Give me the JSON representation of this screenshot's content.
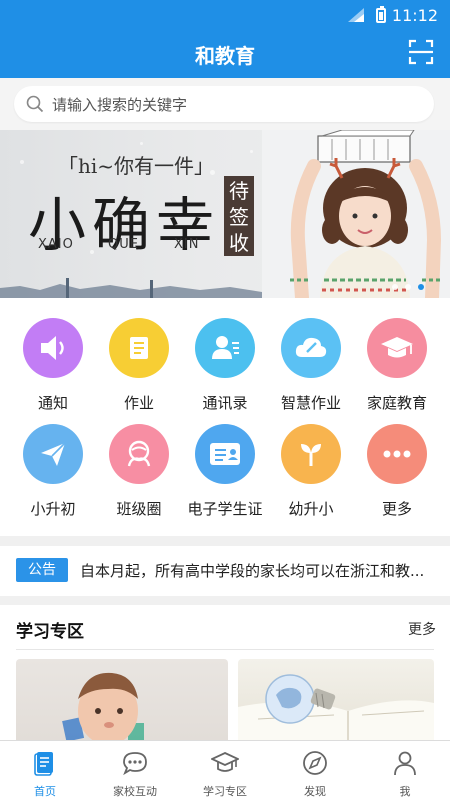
{
  "status_bar": {
    "time": "11:12"
  },
  "header": {
    "title": "和教育"
  },
  "search": {
    "placeholder": "请输入搜索的关键字"
  },
  "banner": {
    "quote": "「hi~你有一件」",
    "headline": "小确幸",
    "pinyin": [
      "XAIO",
      "QUE",
      "XIN"
    ],
    "seal": [
      "待",
      "签",
      "收"
    ],
    "page_count": 3,
    "active_page": 3
  },
  "grid": {
    "items": [
      {
        "label": "通知",
        "color": "#c27df5",
        "icon": "speaker-icon"
      },
      {
        "label": "作业",
        "color": "#f7ce34",
        "icon": "document-icon"
      },
      {
        "label": "通讯录",
        "color": "#4cc0ef",
        "icon": "contact-icon"
      },
      {
        "label": "智慧作业",
        "color": "#5bc1f4",
        "icon": "cloud-pencil-icon"
      },
      {
        "label": "家庭教育",
        "color": "#f68d9f",
        "icon": "graduation-cap-icon"
      },
      {
        "label": "小升初",
        "color": "#66b3ef",
        "icon": "paper-plane-icon"
      },
      {
        "label": "班级圈",
        "color": "#f78ea3",
        "icon": "group-icon"
      },
      {
        "label": "电子学生证",
        "color": "#4fa7ef",
        "icon": "id-card-icon"
      },
      {
        "label": "幼升小",
        "color": "#f8b44e",
        "icon": "sprout-icon"
      },
      {
        "label": "更多",
        "color": "#f58c7a",
        "icon": "more-icon"
      }
    ]
  },
  "notice": {
    "tag": "公告",
    "text": "自本月起，所有高中学段的家长均可以在浙江和教..."
  },
  "study": {
    "title": "学习专区",
    "more": "更多"
  },
  "tabbar": {
    "tabs": [
      {
        "label": "首页",
        "icon": "home-icon",
        "active": true
      },
      {
        "label": "家校互动",
        "icon": "chat-icon",
        "active": false
      },
      {
        "label": "学习专区",
        "icon": "graduation-cap-icon",
        "active": false
      },
      {
        "label": "发现",
        "icon": "compass-icon",
        "active": false
      },
      {
        "label": "我",
        "icon": "person-icon",
        "active": false
      }
    ]
  },
  "colors": {
    "primary": "#1f8fe6",
    "notice_tag": "#2b93e8"
  }
}
